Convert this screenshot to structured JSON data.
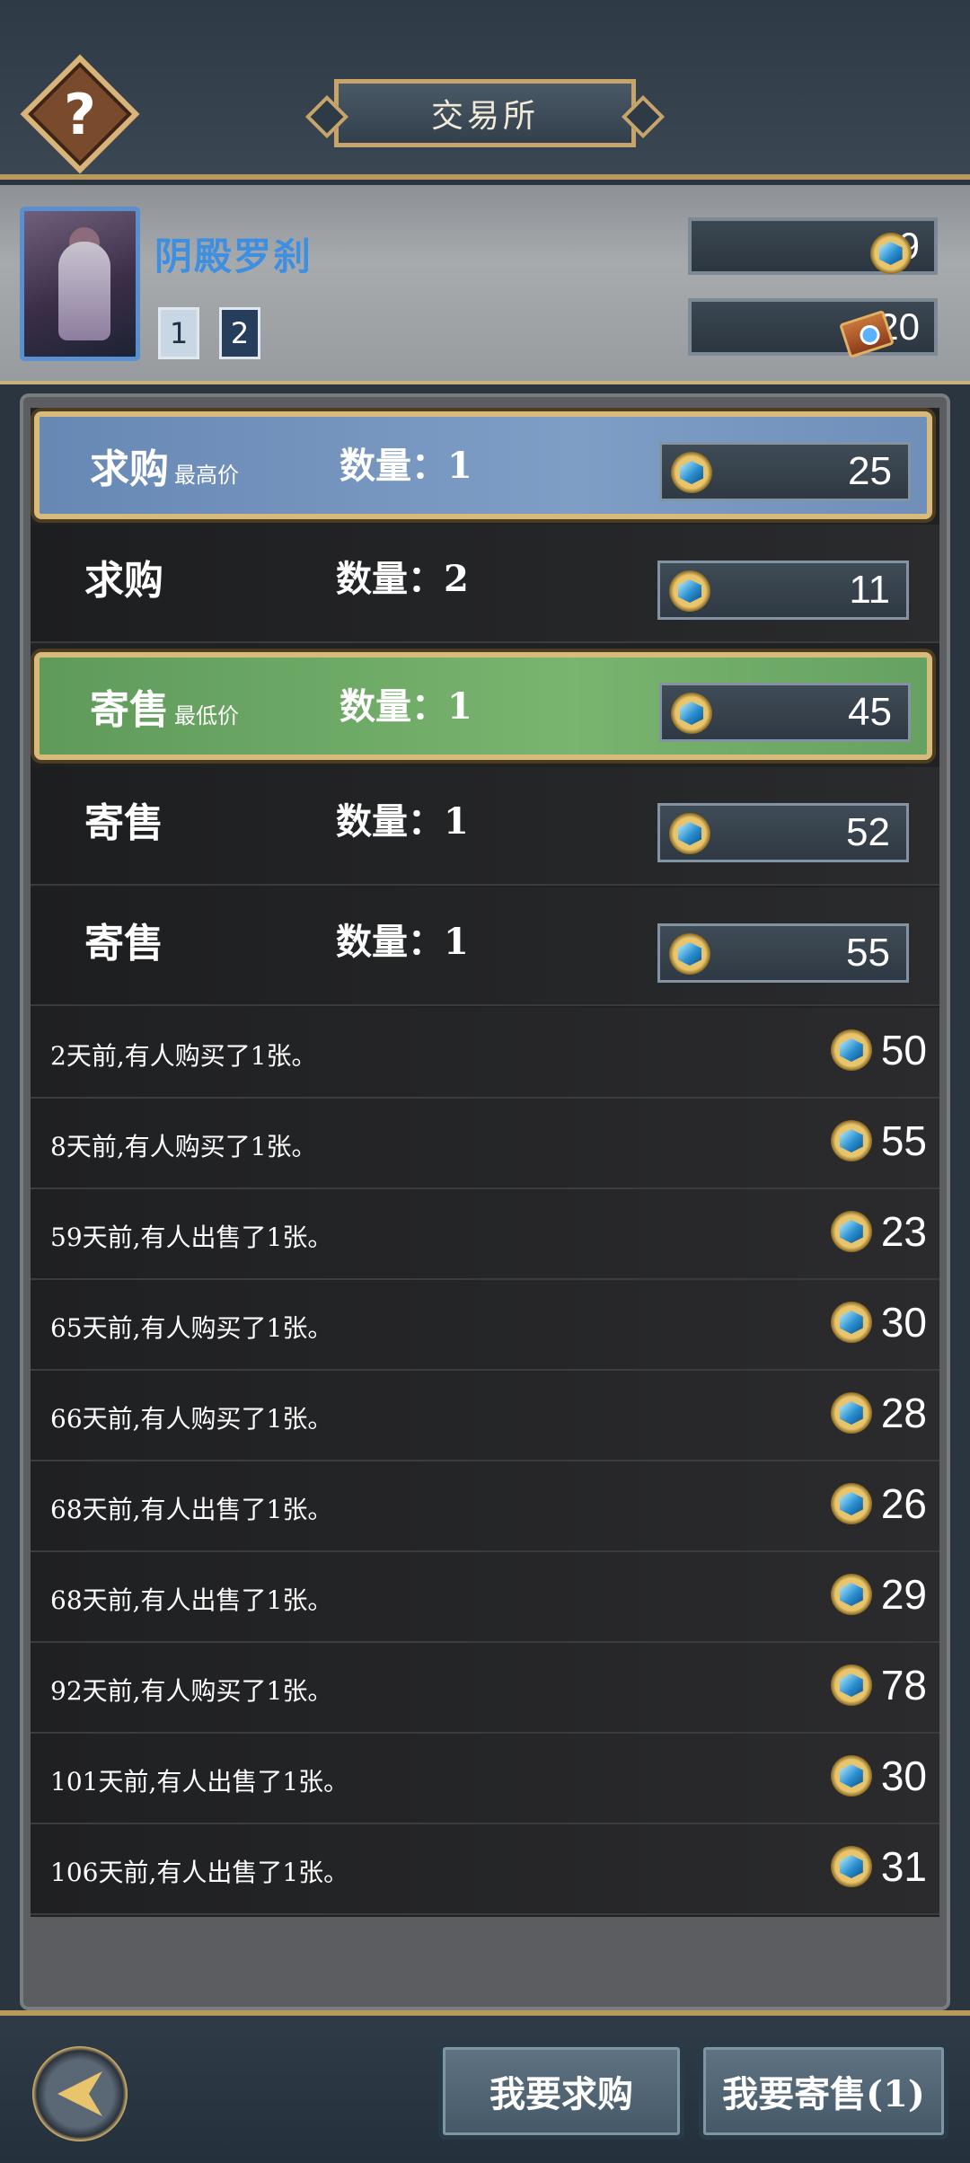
{
  "header": {
    "title": "交易所",
    "help_label": "?"
  },
  "card": {
    "name": "阴殿罗刹",
    "levels": [
      "1",
      "2"
    ],
    "gold": "9",
    "tickets": "20"
  },
  "orders": [
    {
      "type": "求购",
      "tag": "最高价",
      "qty": "数量：1",
      "price": "25"
    },
    {
      "type": "求购",
      "tag": "",
      "qty": "数量：2",
      "price": "11"
    },
    {
      "type": "寄售",
      "tag": "最低价",
      "qty": "数量：1",
      "price": "45"
    },
    {
      "type": "寄售",
      "tag": "",
      "qty": "数量：1",
      "price": "52"
    },
    {
      "type": "寄售",
      "tag": "",
      "qty": "数量：1",
      "price": "55"
    }
  ],
  "history": [
    {
      "text": "2天前,有人购买了1张。",
      "price": "50"
    },
    {
      "text": "8天前,有人购买了1张。",
      "price": "55"
    },
    {
      "text": "59天前,有人出售了1张。",
      "price": "23"
    },
    {
      "text": "65天前,有人购买了1张。",
      "price": "30"
    },
    {
      "text": "66天前,有人购买了1张。",
      "price": "28"
    },
    {
      "text": "68天前,有人出售了1张。",
      "price": "26"
    },
    {
      "text": "68天前,有人出售了1张。",
      "price": "29"
    },
    {
      "text": "92天前,有人购买了1张。",
      "price": "78"
    },
    {
      "text": "101天前,有人出售了1张。",
      "price": "30"
    },
    {
      "text": "106天前,有人出售了1张。",
      "price": "31"
    }
  ],
  "footer": {
    "buy_button": "我要求购",
    "sell_button": "我要寄售(1)"
  },
  "icons": {
    "help": "question-icon",
    "currency": "gem-coin-icon",
    "ticket": "ticket-icon",
    "back": "back-arrow-icon"
  }
}
